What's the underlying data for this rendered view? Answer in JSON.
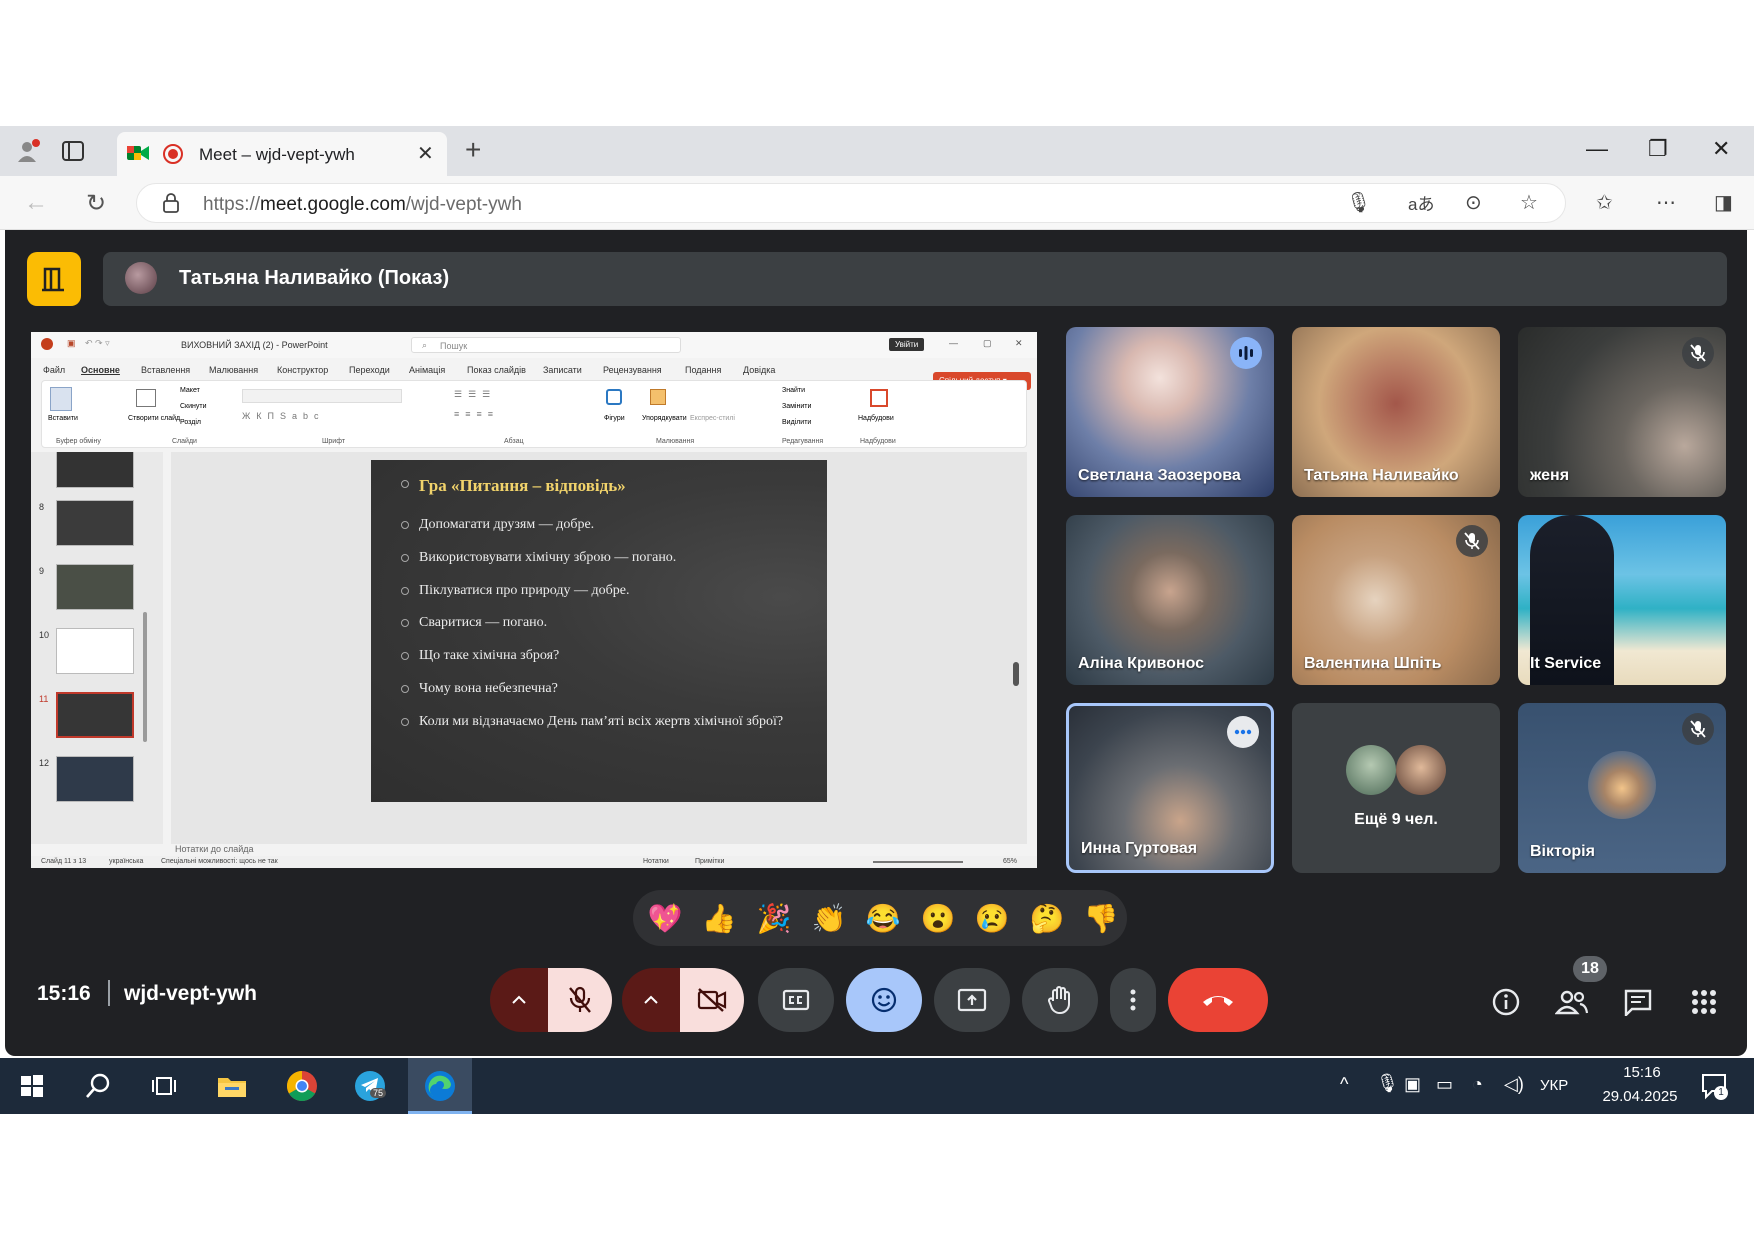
{
  "browser": {
    "tab_title": "Meet – wjd-vept-ywh",
    "url_prefix": "https://",
    "url_domain": "meet.google.com",
    "url_path": "/wjd-vept-ywh"
  },
  "presenter": {
    "label": "Татьяна Наливайко (Показ)"
  },
  "powerpoint": {
    "title": "ВИХОВНИЙ ЗАХІД (2) - PowerPoint",
    "search_placeholder": "Пошук",
    "signin": "Увійти",
    "share": "Спільний доступ",
    "menus": [
      "Файл",
      "Основне",
      "Вставлення",
      "Малювання",
      "Конструктор",
      "Переходи",
      "Анімація",
      "Показ слайдів",
      "Записати",
      "Рецензування",
      "Подання",
      "Довідка"
    ],
    "ribbon_groups": [
      "Буфер обміну",
      "Слайди",
      "Шрифт",
      "Абзац",
      "Малювання",
      "Редагування",
      "Надбудови"
    ],
    "ribbon_items": [
      "Вставити",
      "Створити слайд",
      "Макет",
      "Скинути",
      "Розділ",
      "Фігури",
      "Упорядкувати",
      "Експрес-стилі",
      "Знайти",
      "Замінити",
      "Виділити",
      "Надбудови"
    ],
    "thumb_numbers": [
      "8",
      "9",
      "10",
      "11",
      "12"
    ],
    "notes_placeholder": "Нотатки до слайда",
    "status": {
      "slide": "Слайд 11 з 13",
      "lang": "українська",
      "accessibility": "Спеціальні можливості: щось не так",
      "notes": "Нотатки",
      "comments": "Примітки",
      "zoom": "65%"
    }
  },
  "slide": {
    "title": "Гра «Питання – відповідь»",
    "lines": [
      "Допомагати друзям — добре.",
      "Використовувати хімічну зброю — погано.",
      "Піклуватися про природу — добре.",
      "Сваритися — погано.",
      "Що таке хімічна зброя?",
      "Чому вона небезпечна?",
      "Коли ми відзначаємо День пам’яті всіх жертв хімічної зброї?"
    ]
  },
  "participants": [
    {
      "name": "Светлана Заозерова",
      "state": "speaking"
    },
    {
      "name": "Татьяна Наливайко",
      "state": "none"
    },
    {
      "name": "женя",
      "state": "muted"
    },
    {
      "name": "Аліна Кривонос",
      "state": "none"
    },
    {
      "name": "Валентина Шпіть",
      "state": "muted"
    },
    {
      "name": "It Service",
      "state": "none"
    },
    {
      "name": "Инна Гуртовая",
      "state": "more"
    },
    {
      "name": "Ещё 9 чел.",
      "state": "none"
    },
    {
      "name": "Вікторія",
      "state": "muted"
    }
  ],
  "reactions": [
    "💖",
    "👍",
    "🎉",
    "👏",
    "😂",
    "😮",
    "😢",
    "🤔",
    "👎"
  ],
  "controls": {
    "time": "15:16",
    "meeting_code": "wjd-vept-ywh",
    "people_count": "18"
  },
  "taskbar": {
    "telegram_badge": "75",
    "language": "УКР",
    "time": "15:16",
    "date": "29.04.2025",
    "notification_count": "1"
  },
  "colors": {
    "meet_bg": "#202124",
    "accent_yellow": "#fbbc04",
    "end_call": "#ea4335",
    "active_blue": "#a8c7fa",
    "mic_off": "#f9dedc"
  }
}
